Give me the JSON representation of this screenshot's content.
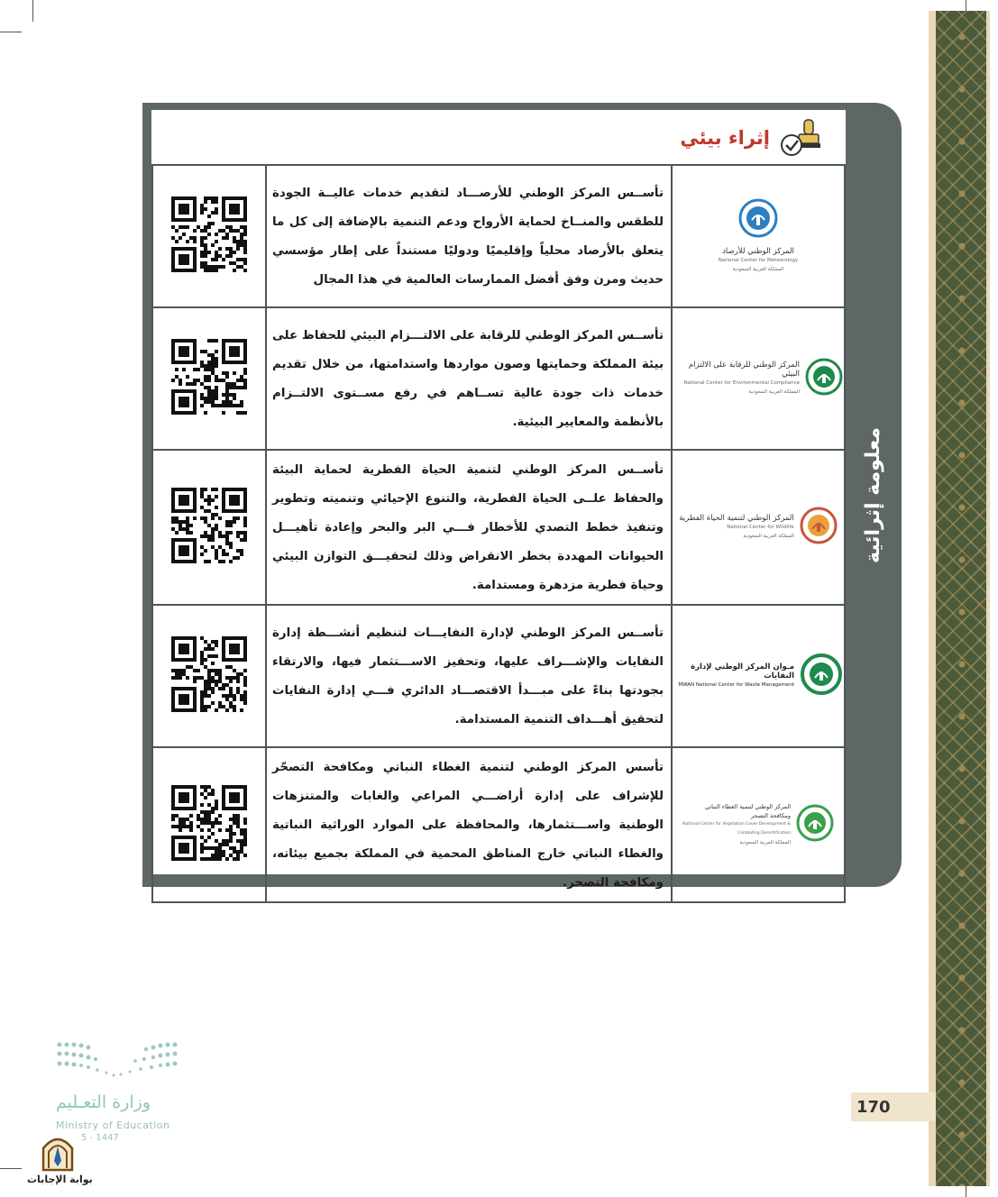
{
  "header": {
    "title": "إثراء بيئي",
    "icon": "stamp-check-icon"
  },
  "side_label": "معلومة إثرائية",
  "rows": [
    {
      "text": "تأســس المركز الوطني للأرصـــاد لتقديم خدمات عاليــة الجودة للطقس والمنــاخ لحماية الأرواح ودعم التنمية بالإضافة إلى كل ما يتعلق بالأرصاد محلياً وإقليميًا ودوليًا مستنداً على إطار مؤسسي حديث ومرن وفق أفضل الممارسات العالمية في هذا المجال",
      "logo_ar": "المركز الوطني للأرصاد",
      "logo_en": "National Center for Meteorology",
      "logo_sub": "المملكة العربية السعودية",
      "logo_color": "#2d7fc1"
    },
    {
      "text": "تأســس المركز الوطني للرقابة على الالتـــزام البيئي للحفاظ على بيئة المملكة وحمايتها وصون مواردها واستدامتها، من خلال تقديم خدمات ذات جودة عالية تســاهم في رفع مســتوى الالتــزام بالأنظمة والمعايير البيئية.",
      "logo_ar": "المركز الوطني للرقابة على الالتزام البيئي",
      "logo_en": "National Center for Environmental Compliance",
      "logo_sub": "المملكة العربية السعودية",
      "logo_color": "#1f8a4c"
    },
    {
      "text": "تأســس المركز الوطني لتنمية الحياة الفطرية لحماية البيئة والحفاظ علــى الحياة الفطرية، والتنوع الإحيائي وتنميته وتطوير وتنفيذ خطط التصدي للأخطار فـــي البر والبحر وإعادة تأهيـــل الحيوانات المهددة بخطر الانقراض وذلك لتحقيـــق التوازن البيئي وحياة فطرية مزدهرة ومستدامة.",
      "logo_ar": "المركز الوطني لتنمية الحياة الفطرية",
      "logo_en": "National Center for Wildlife",
      "logo_sub": "المملكة العربية السعودية",
      "logo_color": "#c8553d"
    },
    {
      "text": "تأســس المركز الوطني لإدارة النفايـــات لتنظيم أنشـــطة إدارة النفايات والإشـــراف عليها، وتحفيز الاســـتثمار فيها، والارتقاء بجودتها بناءً على مبـــدأ الاقتصـــاد الدائري فـــي إدارة النفايات لتحقيق أهـــداف التنمية المستدامة.",
      "logo_ar": "مـوان المركز الوطني لإدارة النفايات",
      "logo_en": "MWAN National Center for Waste Management",
      "logo_sub": "",
      "logo_color": "#1f8a4c"
    },
    {
      "text": "تأسس المركز الوطني لتنمية الغطاء النباتي ومكافحة التصحّر للإشراف على إدارة أراضـــي المراعي والغابات والمتنزهات الوطنية واســـتثمارها، والمحافظة على الموارد الوراثية النباتية والغطاء النباتي خارج المناطق المحمية في المملكة بجميع بيئاته، ومكافحة التصحر.",
      "logo_ar": "المركز الوطني لتنمية الغطاء النباتي ومكافحة التصحر",
      "logo_en": "National Center for Vegetation Cover Development & Combating Desertification",
      "logo_sub": "المملكة العربية السعودية",
      "logo_color": "#3aa04a"
    }
  ],
  "page_number": "170",
  "ministry": {
    "ar": "وزارة التعـليم",
    "en": "Ministry of Education",
    "year": "5 - 1447"
  },
  "answers_portal": "بوابة الإجابات"
}
